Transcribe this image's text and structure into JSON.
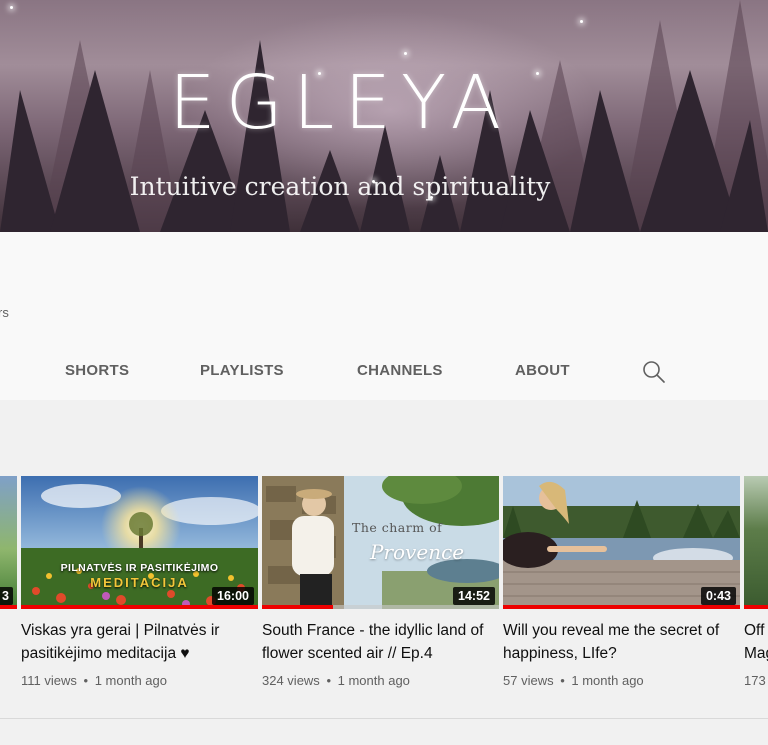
{
  "banner": {
    "title": "EGLEYA",
    "subtitle": "Intuitive creation and spirituality"
  },
  "channel": {
    "subscribers_fragment": "rs"
  },
  "tabs": [
    {
      "label": "SHORTS"
    },
    {
      "label": "PLAYLISTS"
    },
    {
      "label": "CHANNELS"
    },
    {
      "label": "ABOUT"
    }
  ],
  "search": {
    "icon": "search-icon"
  },
  "left_partial": {
    "duration_fragment": "3"
  },
  "videos": [
    {
      "title": "Viskas yra gerai | Pilnatvės ir pasitikėjimo meditacija ♥",
      "views": "111 views",
      "age": "1 month ago",
      "duration": "16:00",
      "progress": 1.0,
      "overlay_line1": "PILNATVĖS IR PASITIKĖJIMO",
      "overlay_line2": "MEDITACIJA"
    },
    {
      "title": "South France - the idyllic land of flower scented air // Ep.4",
      "views": "324 views",
      "age": "1 month ago",
      "duration": "14:52",
      "progress": 0.3,
      "overlay_line1": "The charm of",
      "overlay_line2": "Provence"
    },
    {
      "title": "Will you reveal me the secret of happiness, LIfe?",
      "views": "57 views",
      "age": "1 month ago",
      "duration": "0:43",
      "progress": 1.0
    }
  ],
  "right_partial": {
    "title_line1": "Off",
    "title_line2": "Mag",
    "views_fragment": "173"
  },
  "meta_separator": "•",
  "colors": {
    "background": "#f9f9f9",
    "content_background": "#f1f1f1",
    "progress_red": "#ee0000",
    "tab_text": "#606060"
  }
}
